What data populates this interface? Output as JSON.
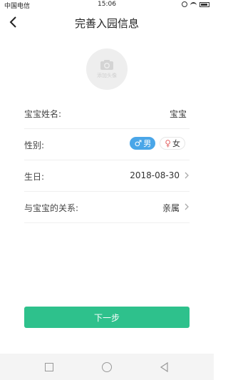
{
  "status_bar": {
    "carrier": "中国电信",
    "time": "15:06"
  },
  "header": {
    "title": "完善入园信息",
    "back_icon": "chevron-left-icon"
  },
  "avatar": {
    "caption": "添加头像",
    "icon": "camera-icon"
  },
  "form": {
    "name_label": "宝宝姓名:",
    "name_value": "宝宝",
    "gender_label": "性别:",
    "gender_options": [
      {
        "symbol": "♂",
        "label": "男",
        "selected": true
      },
      {
        "symbol": "♀",
        "label": "女",
        "selected": false
      }
    ],
    "birthday_label": "生日:",
    "birthday_value": "2018-08-30",
    "relation_label": "与宝宝的关系:",
    "relation_value": "亲属"
  },
  "actions": {
    "next_label": "下一步"
  },
  "colors": {
    "primary_green": "#2ec18c",
    "gender_blue": "#4aa6e8",
    "female_pink": "#e56b6b"
  }
}
